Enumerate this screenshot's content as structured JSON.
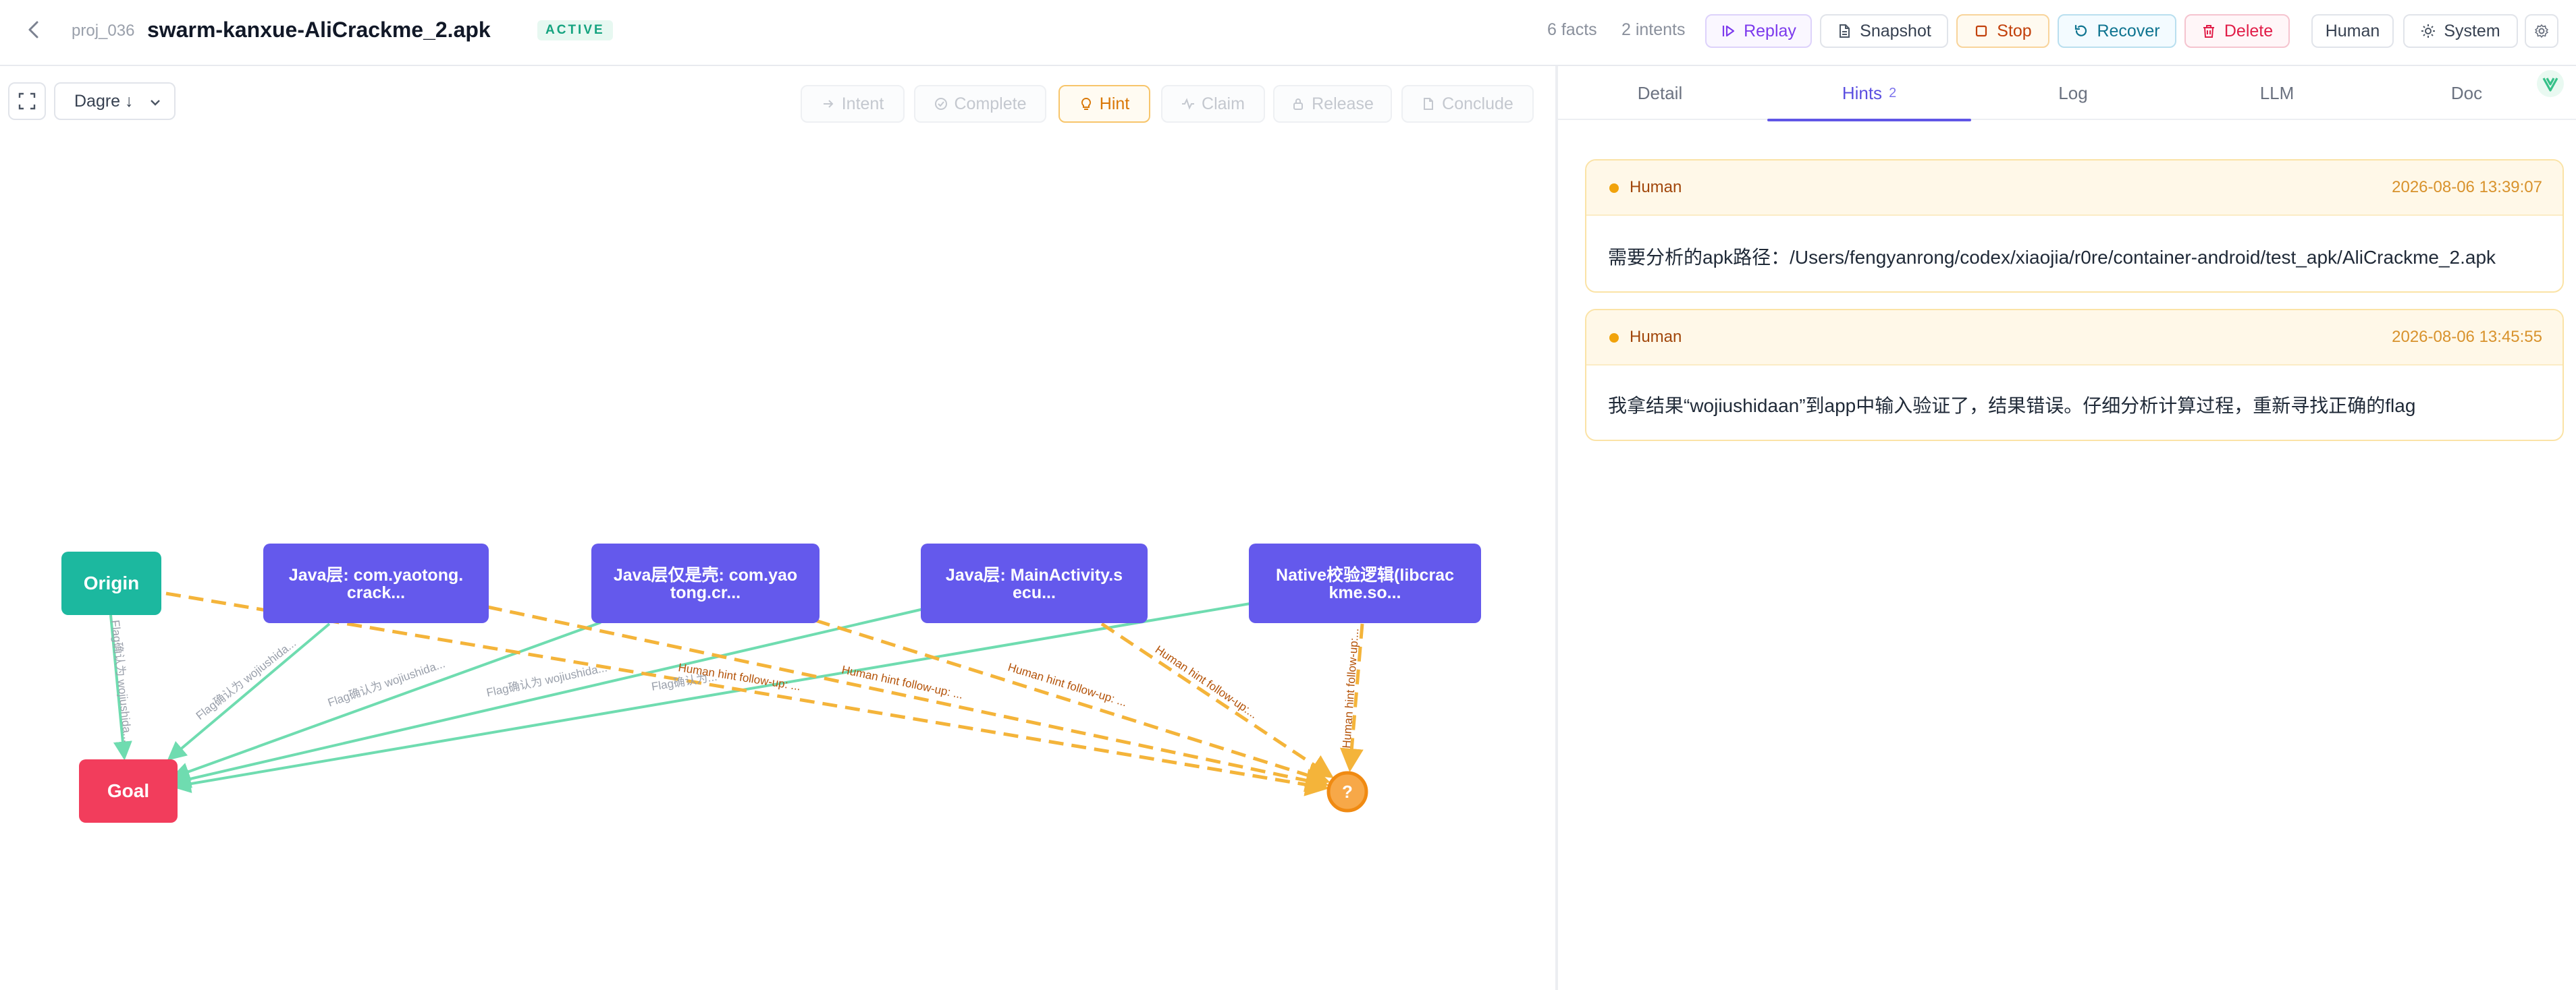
{
  "header": {
    "project_id": "proj_036",
    "project_name": "swarm-kanxue-AliCrackme_2.apk",
    "status": "ACTIVE",
    "facts": "6 facts",
    "intents": "2 intents",
    "buttons": {
      "replay": "Replay",
      "snapshot": "Snapshot",
      "stop": "Stop",
      "recover": "Recover",
      "delete": "Delete",
      "human": "Human",
      "system": "System"
    }
  },
  "canvas": {
    "layout_select": "Dagre ↓",
    "actions": {
      "intent": "Intent",
      "complete": "Complete",
      "hint": "Hint",
      "claim": "Claim",
      "release": "Release",
      "conclude": "Conclude"
    }
  },
  "graph": {
    "nodes": {
      "origin": "Origin",
      "goal": "Goal",
      "unknown": "?",
      "fact1": [
        "Java层: com.yaotong.",
        "crack..."
      ],
      "fact2": [
        "Java层仅是壳: com.yao",
        "tong.cr..."
      ],
      "fact3": [
        "Java层: MainActivity.s",
        "ecu..."
      ],
      "fact4": [
        "Native校验逻辑(libcrac",
        "kme.so..."
      ]
    },
    "edge_labels": {
      "flag_origin": "Flag确认为 wojiushida...",
      "flag_1": "Flag确认为 wojiushida...",
      "flag_2": "Flag确认为 wojiushida...",
      "flag_3": "Flag确认为 wojiushida...",
      "flag_4": "Flag确认为...",
      "human_origin": "Human hint follow-up: ...",
      "human_1": "Human hint follow-up: ...",
      "human_2": "Human hint follow-up: ...",
      "human_3": "Human hint follow-up:...",
      "human_4": "Human hint follow-up:..."
    },
    "colors": {
      "origin": "#1cb89f",
      "goal": "#f23d5c",
      "fact": "#6459ec",
      "unknown": "#f7a848",
      "flag_edge": "#6fdcb0",
      "hint_edge": "#f4b43a"
    }
  },
  "panel": {
    "tabs": [
      "Detail",
      "Hints",
      "Log",
      "LLM",
      "Doc"
    ],
    "hints_count": "2",
    "hints": [
      {
        "author": "Human",
        "time": "2026-08-06 13:39:07",
        "text": "需要分析的apk路径：/Users/fengyanrong/codex/xiaojia/r0re/container-android/test_apk/AliCrackme_2.apk"
      },
      {
        "author": "Human",
        "time": "2026-08-06 13:45:55",
        "text": "我拿结果“wojiushidaan”到app中输入验证了，结果错误。仔细分析计算过程，重新寻找正确的flag"
      }
    ]
  }
}
